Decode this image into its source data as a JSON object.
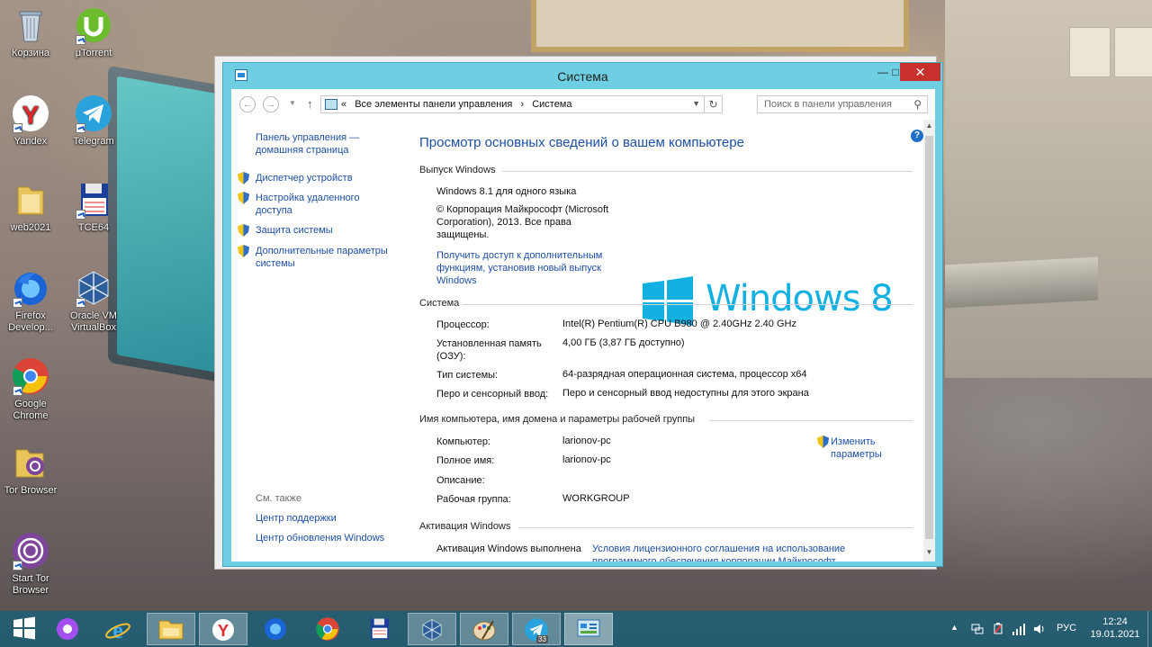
{
  "desktop_icons": [
    {
      "label": "Корзина"
    },
    {
      "label": "µTorrent"
    },
    {
      "label": "Yandex"
    },
    {
      "label": "Telegram"
    },
    {
      "label": "web2021"
    },
    {
      "label": "TCE64"
    },
    {
      "label": "Firefox Develop..."
    },
    {
      "label": "Oracle VM VirtualBox"
    },
    {
      "label": "Google Chrome"
    },
    {
      "label": "Tor Browser"
    },
    {
      "label": "Start Tor Browser"
    }
  ],
  "window": {
    "title": "Система",
    "breadcrumb_prefix": "«",
    "breadcrumbs": [
      "Все элементы панели управления",
      "Система"
    ],
    "breadcrumb_separator": "›",
    "search_placeholder": "Поиск в панели управления"
  },
  "left_pane": {
    "home_link": "Панель управления — домашняя страница",
    "links": [
      "Диспетчер устройств",
      "Настройка удаленного доступа",
      "Защита системы",
      "Дополнительные параметры системы"
    ],
    "see_also_title": "См. также",
    "see_also": [
      "Центр поддержки",
      "Центр обновления Windows"
    ]
  },
  "main": {
    "heading": "Просмотр основных сведений о вашем компьютере",
    "edition_section": "Выпуск Windows",
    "edition": "Windows 8.1 для одного языка",
    "copyright": "© Корпорация Майкрософт (Microsoft Corporation), 2013. Все права защищены.",
    "upgrade_link": "Получить доступ к дополнительным функциям, установив новый выпуск Windows",
    "logo_text": "Windows",
    "logo_version": "8",
    "system_section": "Система",
    "system_rows": [
      {
        "label": "Процессор:",
        "value": "Intel(R) Pentium(R) CPU B980 @ 2.40GHz   2.40 GHz"
      },
      {
        "label": "Установленная память (ОЗУ):",
        "value": "4,00 ГБ (3,87 ГБ доступно)"
      },
      {
        "label": "Тип системы:",
        "value": "64-разрядная операционная система, процессор x64"
      },
      {
        "label": "Перо и сенсорный ввод:",
        "value": "Перо и сенсорный ввод недоступны для этого экрана"
      }
    ],
    "computer_section": "Имя компьютера, имя домена и параметры рабочей группы",
    "computer_rows": [
      {
        "label": "Компьютер:",
        "value": "larionov-pc"
      },
      {
        "label": "Полное имя:",
        "value": "larionov-pc"
      },
      {
        "label": "Описание:",
        "value": ""
      },
      {
        "label": "Рабочая группа:",
        "value": "WORKGROUP"
      }
    ],
    "change_settings": "Изменить параметры",
    "activation_section": "Активация Windows",
    "activation_label": "Активация Windows выполнена",
    "activation_link": "Условия лицензионного соглашения на использование программного обеспечения корпорации Майкрософт"
  },
  "taskbar": {
    "language": "РУС",
    "time": "12:24",
    "date": "19.01.2021",
    "telegram_badge": "33"
  },
  "colors": {
    "window_frame": "#6ecfe3",
    "link": "#1d4fa5",
    "windows_logo": "#13b0e2",
    "close_button": "#c7302b"
  }
}
